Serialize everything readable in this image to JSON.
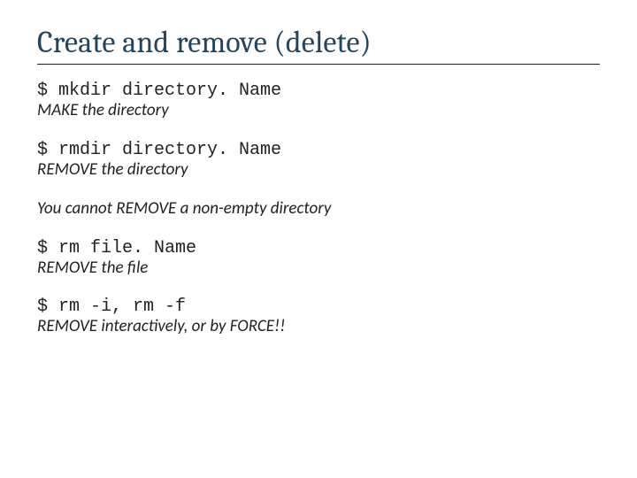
{
  "title": "Create and remove (delete)",
  "blocks": {
    "mkdir": {
      "cmd": "$ mkdir directory. Name",
      "desc": "MAKE the directory"
    },
    "rmdir": {
      "cmd": "$ rmdir directory. Name",
      "desc": "REMOVE the directory"
    },
    "note": "You cannot REMOVE a non-empty directory",
    "rm": {
      "cmd": "$ rm file. Name",
      "desc": "REMOVE the file"
    },
    "rmflags": {
      "cmd": "$ rm -i, rm -f",
      "desc": "REMOVE interactively, or by FORCE!!"
    }
  }
}
